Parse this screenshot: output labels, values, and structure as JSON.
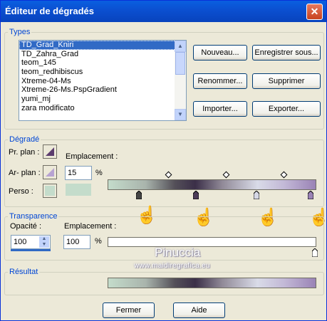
{
  "window": {
    "title": "Éditeur de dégradés",
    "close_glyph": "✕"
  },
  "types": {
    "legend": "Types",
    "items": [
      "TD_Grad_Kniri",
      "TD_Zahra_Grad",
      "teom_145",
      "teom_redhibiscus",
      "Xtreme-04-Ms",
      "Xtreme-26-Ms.PspGradient",
      "yumi_mj",
      "zara modificato"
    ],
    "selected": 0,
    "buttons": {
      "new": "Nouveau...",
      "save_as": "Enregistrer sous...",
      "rename": "Renommer...",
      "delete": "Supprimer",
      "import": "Importer...",
      "export": "Exporter..."
    }
  },
  "gradient": {
    "legend": "Dégradé",
    "foreground_label": "Pr. plan :",
    "background_label": "Ar- plan :",
    "custom_label": "Perso :",
    "location_label": "Emplacement :",
    "location_value": "15",
    "percent": "%"
  },
  "transparency": {
    "legend": "Transparence",
    "opacity_label": "Opacité :",
    "opacity_value": "100",
    "location_label": "Emplacement :",
    "location_value": "100",
    "percent": "%"
  },
  "result": {
    "legend": "Résultat"
  },
  "footer": {
    "close": "Fermer",
    "help": "Aide"
  },
  "watermark": {
    "name": "Pinuccia",
    "url": "www.maidiregrafica.eu"
  },
  "colors": {
    "title_bar": "#0b4fd0",
    "legend": "#0046d5",
    "selection": "#316ac5",
    "custom_swatch": "#c4dccb"
  }
}
